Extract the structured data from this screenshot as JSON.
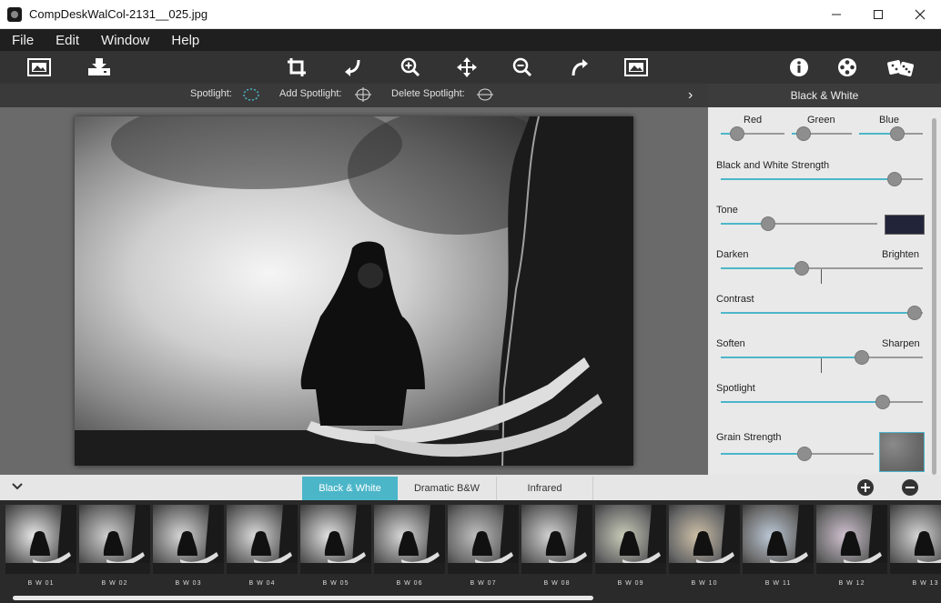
{
  "window": {
    "title": "CompDeskWalCol-2131__025.jpg",
    "min": "—",
    "max": "☐",
    "close": "✕"
  },
  "menu": [
    "File",
    "Edit",
    "Window",
    "Help"
  ],
  "spotlight": {
    "spotlight_label": "Spotlight:",
    "add_label": "Add Spotlight:",
    "delete_label": "Delete Spotlight:"
  },
  "panel": {
    "title": "Black & White",
    "labels": {
      "red": "Red",
      "green": "Green",
      "blue": "Blue",
      "bw_strength": "Black and White Strength",
      "tone": "Tone",
      "darken": "Darken",
      "brighten": "Brighten",
      "contrast": "Contrast",
      "soften": "Soften",
      "sharpen": "Sharpen",
      "spotlight": "Spotlight",
      "grain": "Grain Strength"
    },
    "values": {
      "red": 0.25,
      "green": 0.2,
      "blue": 0.6,
      "bw_strength": 0.86,
      "tone": 0.3,
      "darken_brighten": 0.4,
      "contrast": 0.96,
      "soften_sharpen": 0.7,
      "spotlight": 0.8,
      "grain": 0.55
    },
    "tone_swatch_color": "#22243a"
  },
  "tabs": [
    "Black & White",
    "Dramatic B&W",
    "Infrared"
  ],
  "presets": [
    "B W 01",
    "B W 02",
    "B W 03",
    "B W 04",
    "B W 05",
    "B W 06",
    "B W 07",
    "B W 08",
    "B W 09",
    "B W 10",
    "B W 11",
    "B W 12",
    "B W 13"
  ],
  "colors": {
    "accent": "#4cb6c9"
  }
}
